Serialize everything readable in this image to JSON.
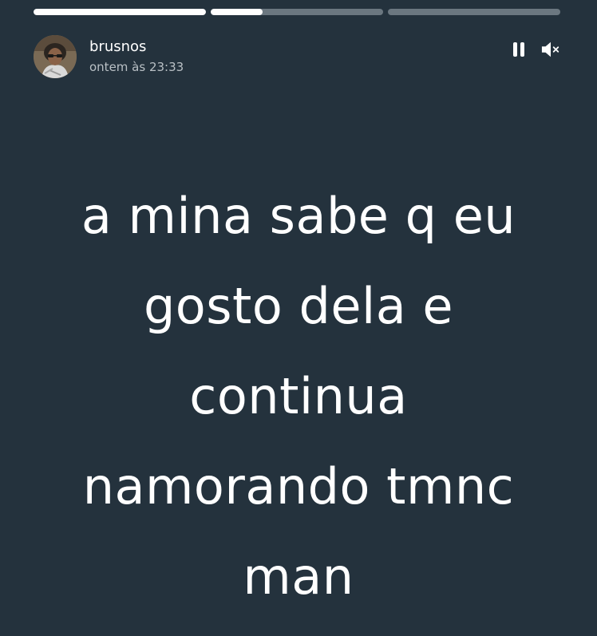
{
  "progress": {
    "segments": [
      {
        "fill": 1.0
      },
      {
        "fill": 0.3
      },
      {
        "fill": 0.0
      }
    ]
  },
  "header": {
    "username": "brusnos",
    "timestamp": "ontem às 23:33",
    "avatar_icon": "user-avatar-photo",
    "pause_icon": "pause-icon",
    "mute_icon": "volume-muted-icon"
  },
  "story": {
    "lines": [
      "a mina sabe q eu",
      "gosto dela e",
      "continua",
      "namorando tmnc",
      "man"
    ],
    "background_color": "#24323d",
    "text_color": "#ffffff"
  }
}
